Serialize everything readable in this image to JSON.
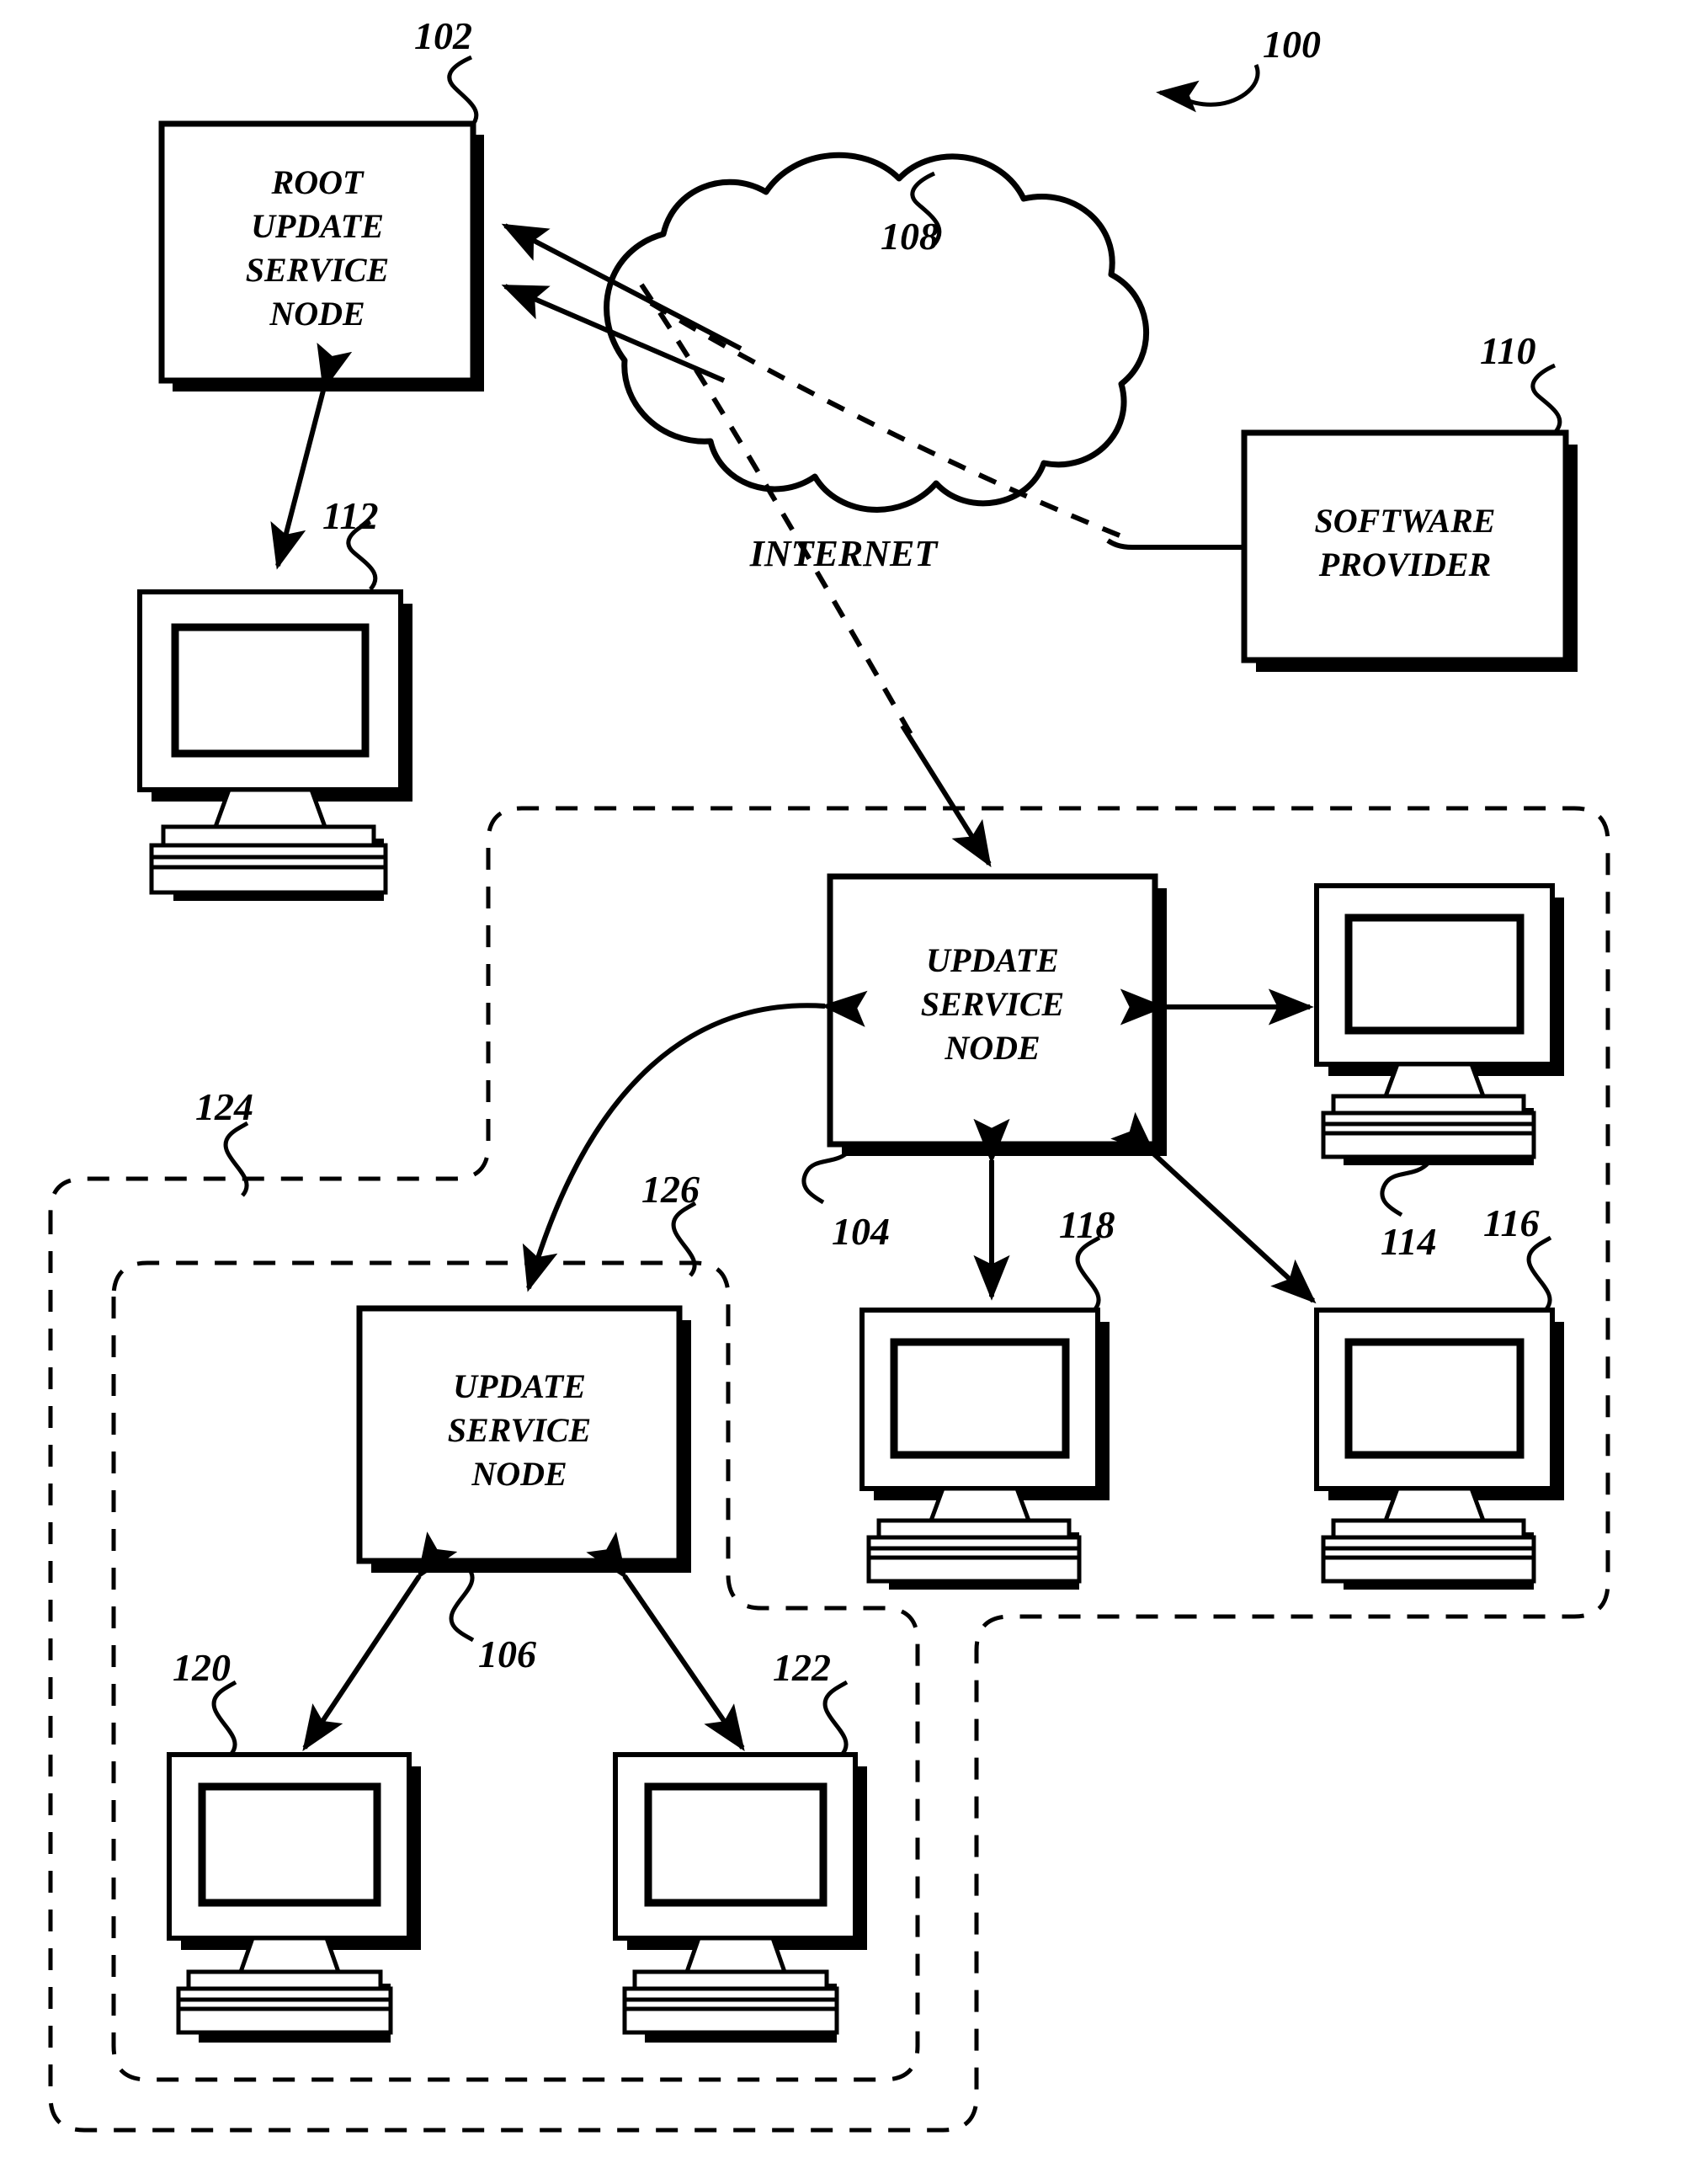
{
  "figure": {
    "title": "Update service node network topology diagram",
    "background_color": "#ffffff",
    "line_color": "#000000"
  },
  "nodes": {
    "root_update_service_node": {
      "ref": "102",
      "lines": [
        "ROOT",
        "UPDATE",
        "SERVICE",
        "NODE"
      ]
    },
    "software_provider": {
      "ref": "110",
      "lines": [
        "SOFTWARE",
        "PROVIDER"
      ]
    },
    "internet_cloud": {
      "ref": "108",
      "label": "INTERNET"
    },
    "update_service_node_104": {
      "ref": "104",
      "lines": [
        "UPDATE",
        "SERVICE",
        "NODE"
      ]
    },
    "update_service_node_106": {
      "ref": "106",
      "lines": [
        "UPDATE",
        "SERVICE",
        "NODE"
      ]
    }
  },
  "clients": [
    {
      "ref": "112",
      "name": "client-computer-112"
    },
    {
      "ref": "114",
      "name": "client-computer-114"
    },
    {
      "ref": "116",
      "name": "client-computer-116"
    },
    {
      "ref": "118",
      "name": "client-computer-118"
    },
    {
      "ref": "120",
      "name": "client-computer-120"
    },
    {
      "ref": "122",
      "name": "client-computer-122"
    }
  ],
  "zones": [
    {
      "ref": "124",
      "name": "dashed-zone-124"
    },
    {
      "ref": "126",
      "name": "dashed-zone-126"
    }
  ],
  "figure_ref": {
    "ref": "100"
  },
  "refs": {
    "r100": "100",
    "r102": "102",
    "r104": "104",
    "r106": "106",
    "r108": "108",
    "r110": "110",
    "r112": "112",
    "r114": "114",
    "r116": "116",
    "r118": "118",
    "r120": "120",
    "r122": "122",
    "r124": "124",
    "r126": "126"
  },
  "text": {
    "root": {
      "l1": "ROOT",
      "l2": "UPDATE",
      "l3": "SERVICE",
      "l4": "NODE"
    },
    "provider": {
      "l1": "SOFTWARE",
      "l2": "PROVIDER"
    },
    "internet": "INTERNET",
    "usn104": {
      "l1": "UPDATE",
      "l2": "SERVICE",
      "l3": "NODE"
    },
    "usn106": {
      "l1": "UPDATE",
      "l2": "SERVICE",
      "l3": "NODE"
    }
  }
}
